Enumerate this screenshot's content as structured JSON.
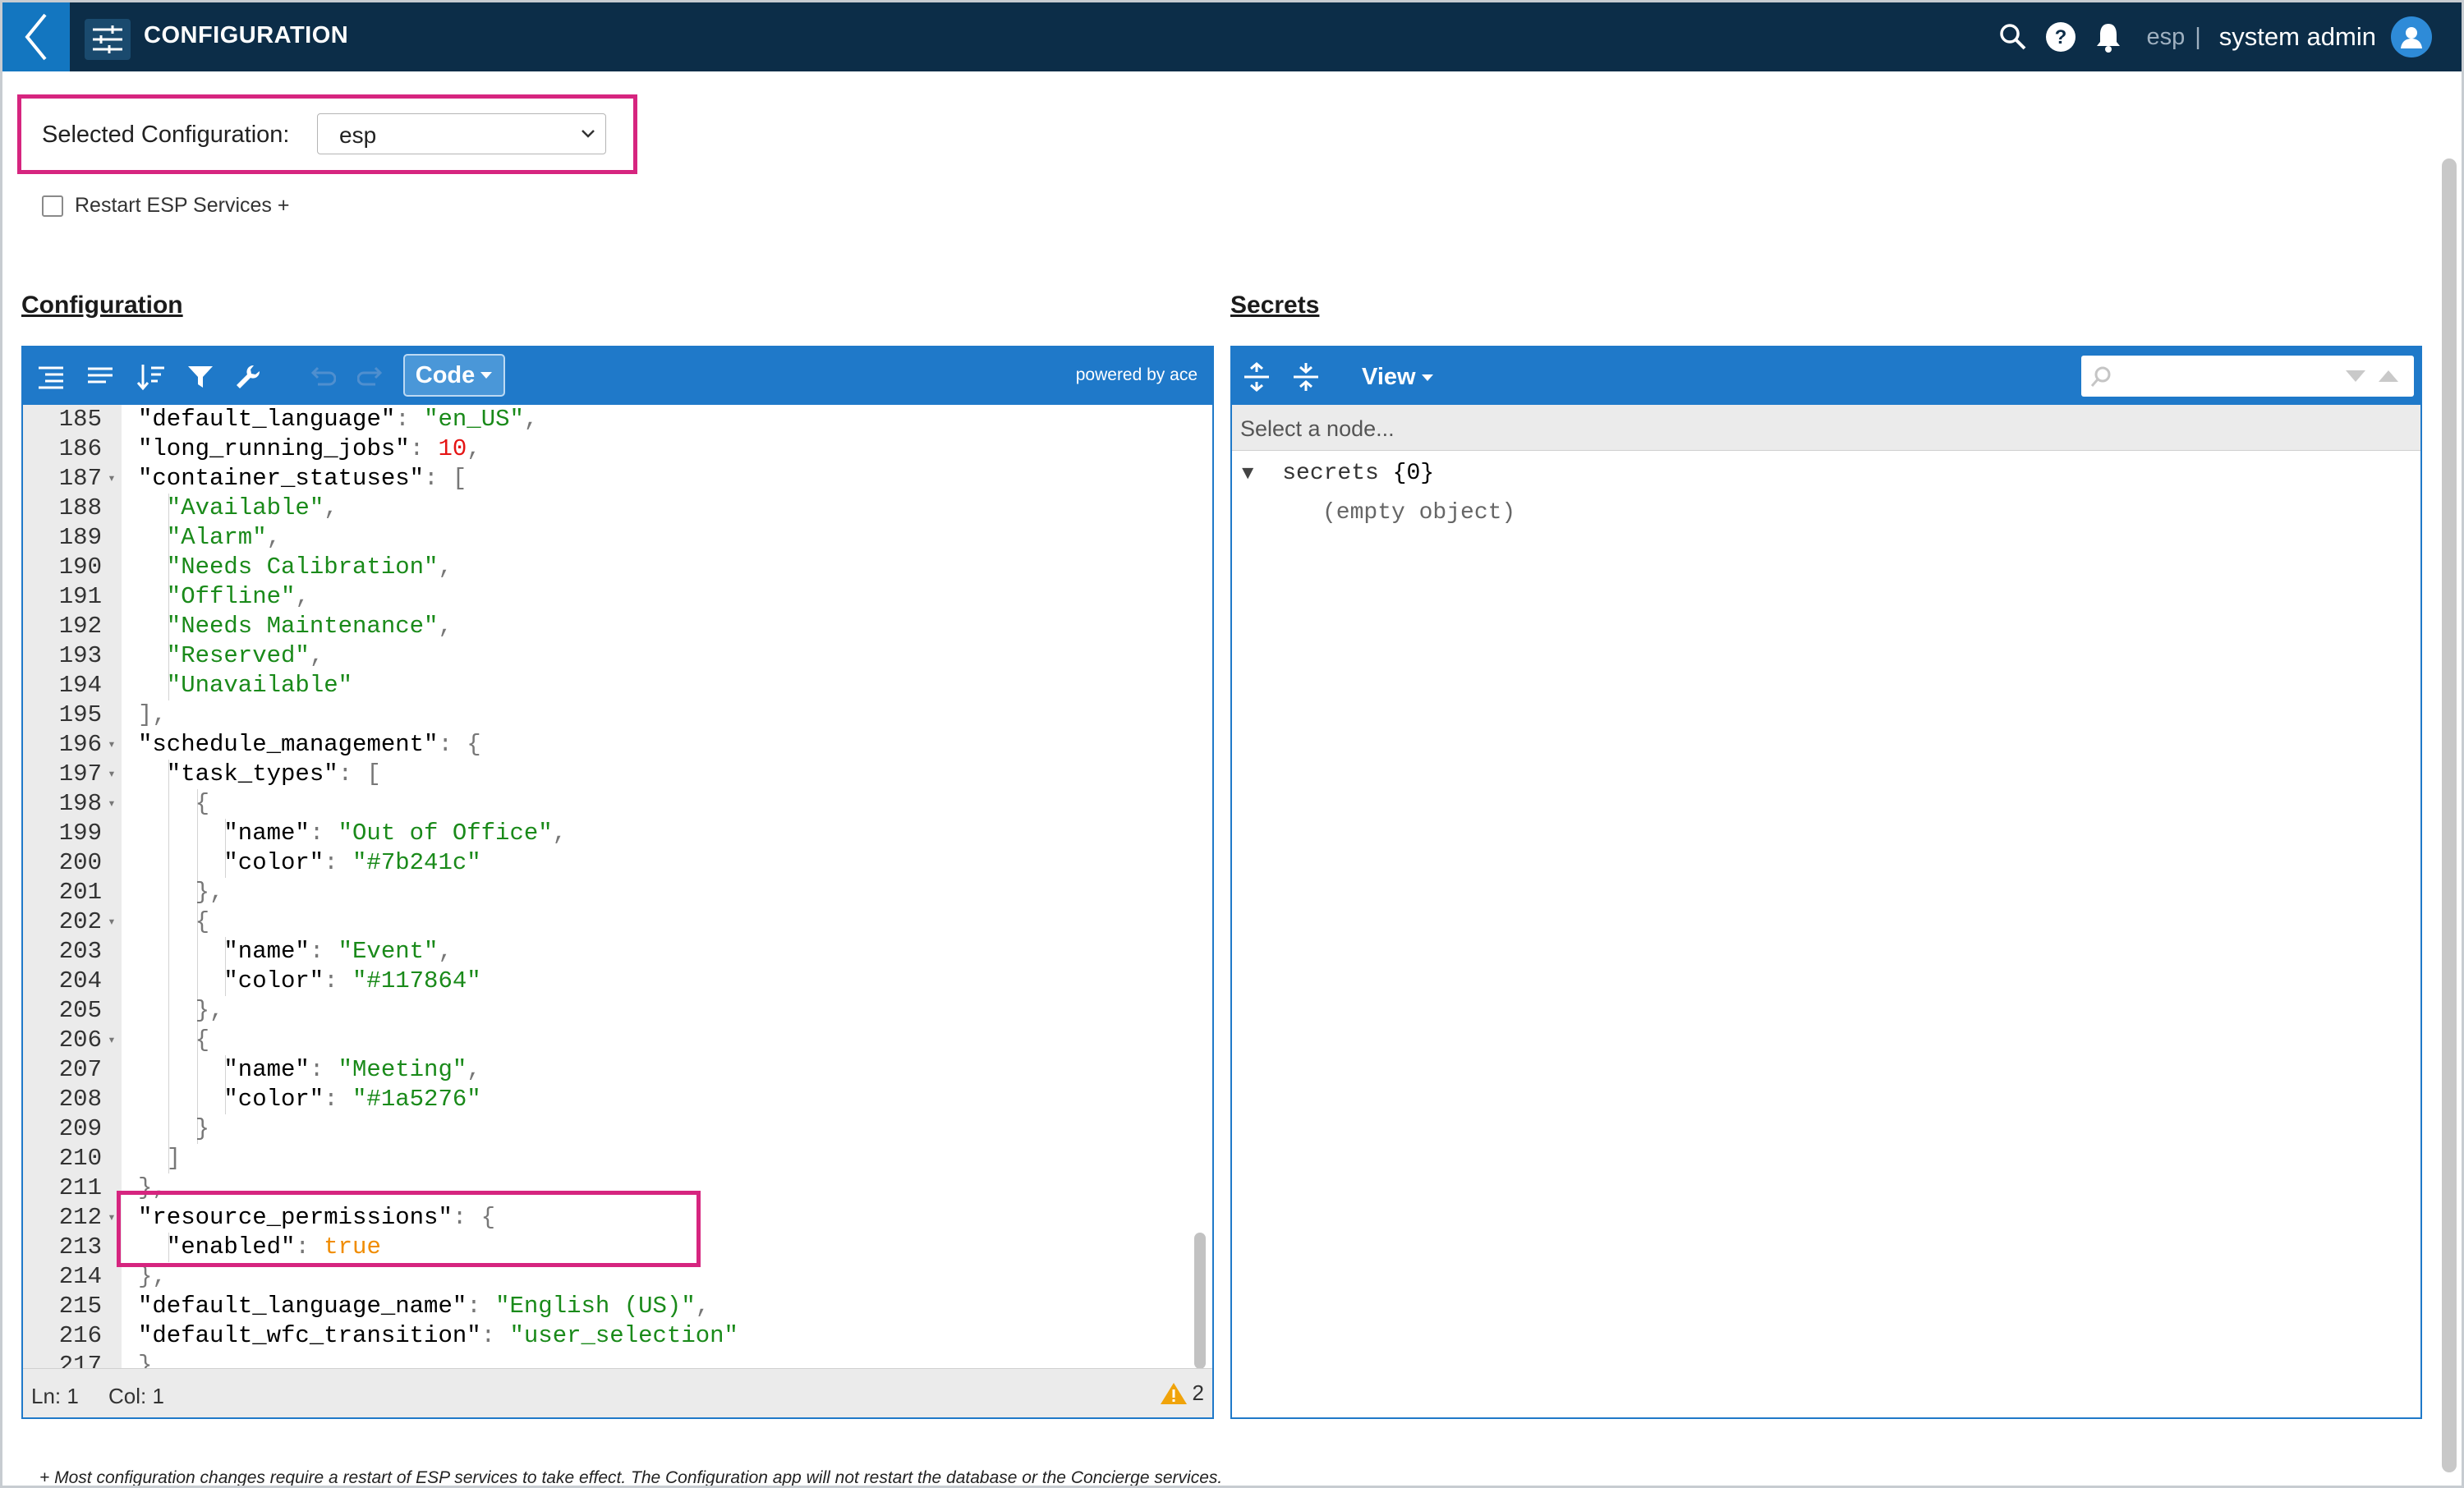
{
  "header": {
    "app_title": "CONFIGURATION",
    "tenant": "esp",
    "separator": "|",
    "user_name": "system admin",
    "icons": [
      "back-chevron-icon",
      "sliders-icon",
      "search-icon",
      "help-icon",
      "bell-icon",
      "user-avatar-icon"
    ]
  },
  "selector": {
    "label": "Selected Configuration:",
    "value": "esp"
  },
  "restart": {
    "label": "Restart ESP Services +",
    "checked": false
  },
  "sections": {
    "configuration": "Configuration",
    "secrets": "Secrets"
  },
  "editor": {
    "mode_label": "Code",
    "powered_by": "powered by ace",
    "status_line": "Ln: 1",
    "status_col": "Col: 1",
    "warning_count": "2",
    "lines": [
      {
        "n": "185",
        "fold": false,
        "indent": 1,
        "tokens": [
          {
            "t": "key",
            "v": "\"default_language\""
          },
          {
            "t": "p",
            "v": ": "
          },
          {
            "t": "str",
            "v": "\"en_US\""
          },
          {
            "t": "p",
            "v": ","
          }
        ]
      },
      {
        "n": "186",
        "fold": false,
        "indent": 1,
        "tokens": [
          {
            "t": "key",
            "v": "\"long_running_jobs\""
          },
          {
            "t": "p",
            "v": ": "
          },
          {
            "t": "num",
            "v": "10"
          },
          {
            "t": "p",
            "v": ","
          }
        ]
      },
      {
        "n": "187",
        "fold": true,
        "indent": 1,
        "tokens": [
          {
            "t": "key",
            "v": "\"container_statuses\""
          },
          {
            "t": "p",
            "v": ": ["
          }
        ]
      },
      {
        "n": "188",
        "fold": false,
        "indent": 2,
        "tokens": [
          {
            "t": "str",
            "v": "\"Available\""
          },
          {
            "t": "p",
            "v": ","
          }
        ]
      },
      {
        "n": "189",
        "fold": false,
        "indent": 2,
        "tokens": [
          {
            "t": "str",
            "v": "\"Alarm\""
          },
          {
            "t": "p",
            "v": ","
          }
        ]
      },
      {
        "n": "190",
        "fold": false,
        "indent": 2,
        "tokens": [
          {
            "t": "str",
            "v": "\"Needs Calibration\""
          },
          {
            "t": "p",
            "v": ","
          }
        ]
      },
      {
        "n": "191",
        "fold": false,
        "indent": 2,
        "tokens": [
          {
            "t": "str",
            "v": "\"Offline\""
          },
          {
            "t": "p",
            "v": ","
          }
        ]
      },
      {
        "n": "192",
        "fold": false,
        "indent": 2,
        "tokens": [
          {
            "t": "str",
            "v": "\"Needs Maintenance\""
          },
          {
            "t": "p",
            "v": ","
          }
        ]
      },
      {
        "n": "193",
        "fold": false,
        "indent": 2,
        "tokens": [
          {
            "t": "str",
            "v": "\"Reserved\""
          },
          {
            "t": "p",
            "v": ","
          }
        ]
      },
      {
        "n": "194",
        "fold": false,
        "indent": 2,
        "tokens": [
          {
            "t": "str",
            "v": "\"Unavailable\""
          }
        ]
      },
      {
        "n": "195",
        "fold": false,
        "indent": 1,
        "tokens": [
          {
            "t": "p",
            "v": "],"
          }
        ]
      },
      {
        "n": "196",
        "fold": true,
        "indent": 1,
        "tokens": [
          {
            "t": "key",
            "v": "\"schedule_management\""
          },
          {
            "t": "p",
            "v": ": {"
          }
        ]
      },
      {
        "n": "197",
        "fold": true,
        "indent": 2,
        "tokens": [
          {
            "t": "key",
            "v": "\"task_types\""
          },
          {
            "t": "p",
            "v": ": ["
          }
        ]
      },
      {
        "n": "198",
        "fold": true,
        "indent": 3,
        "tokens": [
          {
            "t": "p",
            "v": "{"
          }
        ]
      },
      {
        "n": "199",
        "fold": false,
        "indent": 4,
        "tokens": [
          {
            "t": "key",
            "v": "\"name\""
          },
          {
            "t": "p",
            "v": ": "
          },
          {
            "t": "str",
            "v": "\"Out of Office\""
          },
          {
            "t": "p",
            "v": ","
          }
        ]
      },
      {
        "n": "200",
        "fold": false,
        "indent": 4,
        "tokens": [
          {
            "t": "key",
            "v": "\"color\""
          },
          {
            "t": "p",
            "v": ": "
          },
          {
            "t": "str",
            "v": "\"#7b241c\""
          }
        ]
      },
      {
        "n": "201",
        "fold": false,
        "indent": 3,
        "tokens": [
          {
            "t": "p",
            "v": "},"
          }
        ]
      },
      {
        "n": "202",
        "fold": true,
        "indent": 3,
        "tokens": [
          {
            "t": "p",
            "v": "{"
          }
        ]
      },
      {
        "n": "203",
        "fold": false,
        "indent": 4,
        "tokens": [
          {
            "t": "key",
            "v": "\"name\""
          },
          {
            "t": "p",
            "v": ": "
          },
          {
            "t": "str",
            "v": "\"Event\""
          },
          {
            "t": "p",
            "v": ","
          }
        ]
      },
      {
        "n": "204",
        "fold": false,
        "indent": 4,
        "tokens": [
          {
            "t": "key",
            "v": "\"color\""
          },
          {
            "t": "p",
            "v": ": "
          },
          {
            "t": "str",
            "v": "\"#117864\""
          }
        ]
      },
      {
        "n": "205",
        "fold": false,
        "indent": 3,
        "tokens": [
          {
            "t": "p",
            "v": "},"
          }
        ]
      },
      {
        "n": "206",
        "fold": true,
        "indent": 3,
        "tokens": [
          {
            "t": "p",
            "v": "{"
          }
        ]
      },
      {
        "n": "207",
        "fold": false,
        "indent": 4,
        "tokens": [
          {
            "t": "key",
            "v": "\"name\""
          },
          {
            "t": "p",
            "v": ": "
          },
          {
            "t": "str",
            "v": "\"Meeting\""
          },
          {
            "t": "p",
            "v": ","
          }
        ]
      },
      {
        "n": "208",
        "fold": false,
        "indent": 4,
        "tokens": [
          {
            "t": "key",
            "v": "\"color\""
          },
          {
            "t": "p",
            "v": ": "
          },
          {
            "t": "str",
            "v": "\"#1a5276\""
          }
        ]
      },
      {
        "n": "209",
        "fold": false,
        "indent": 3,
        "tokens": [
          {
            "t": "p",
            "v": "}"
          }
        ]
      },
      {
        "n": "210",
        "fold": false,
        "indent": 2,
        "tokens": [
          {
            "t": "p",
            "v": "]"
          }
        ]
      },
      {
        "n": "211",
        "fold": false,
        "indent": 1,
        "tokens": [
          {
            "t": "p",
            "v": "},"
          }
        ]
      },
      {
        "n": "212",
        "fold": true,
        "indent": 1,
        "tokens": [
          {
            "t": "key",
            "v": "\"resource_permissions\""
          },
          {
            "t": "p",
            "v": ": {"
          }
        ]
      },
      {
        "n": "213",
        "fold": false,
        "indent": 2,
        "tokens": [
          {
            "t": "key",
            "v": "\"enabled\""
          },
          {
            "t": "p",
            "v": ": "
          },
          {
            "t": "bool",
            "v": "true"
          }
        ]
      },
      {
        "n": "214",
        "fold": false,
        "indent": 1,
        "tokens": [
          {
            "t": "p",
            "v": "},"
          }
        ]
      },
      {
        "n": "215",
        "fold": false,
        "indent": 1,
        "tokens": [
          {
            "t": "key",
            "v": "\"default_language_name\""
          },
          {
            "t": "p",
            "v": ": "
          },
          {
            "t": "str",
            "v": "\"English (US)\""
          },
          {
            "t": "p",
            "v": ","
          }
        ]
      },
      {
        "n": "216",
        "fold": false,
        "indent": 1,
        "tokens": [
          {
            "t": "key",
            "v": "\"default_wfc_transition\""
          },
          {
            "t": "p",
            "v": ": "
          },
          {
            "t": "str",
            "v": "\"user_selection\""
          }
        ]
      },
      {
        "n": "217",
        "fold": false,
        "indent": 0,
        "tokens": [
          {
            "t": "p",
            "v": "}"
          }
        ]
      }
    ]
  },
  "secrets": {
    "view_label": "View",
    "nav_placeholder": "Select a node...",
    "root_key": "secrets",
    "root_count": "{0}",
    "empty_text": "(empty object)"
  },
  "footnote": "+ Most configuration changes require a restart of ESP services to take effect. The Configuration app will not restart the database or the Concierge services.",
  "colors": {
    "topbar": "#0c2d48",
    "accent_blue": "#1f79c9",
    "highlight_pink": "#d6257f",
    "string_green": "#1a8a1a",
    "number_red": "#e51414",
    "boolean_orange": "#f08c00"
  }
}
